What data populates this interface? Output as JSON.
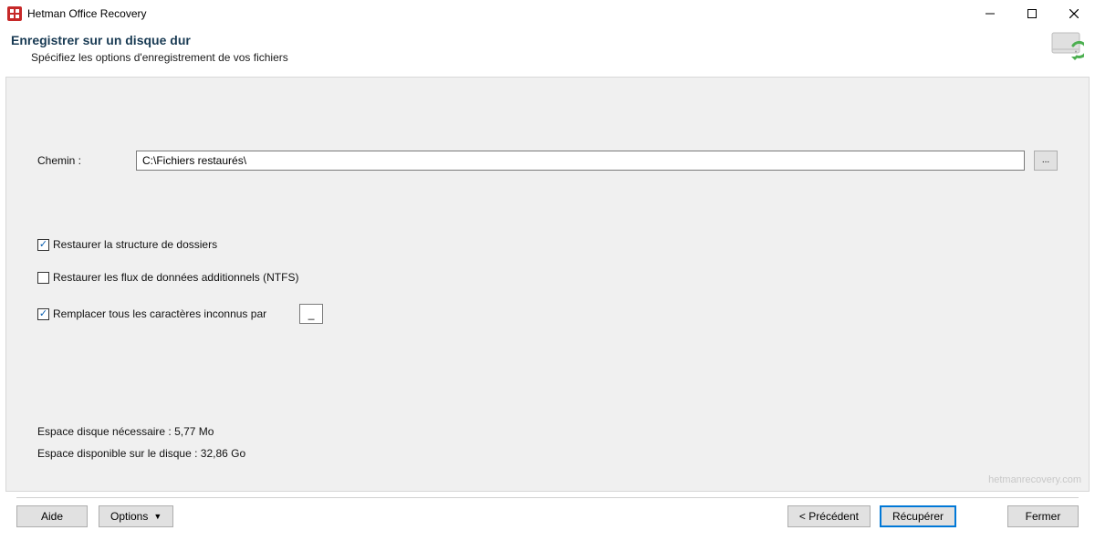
{
  "titlebar": {
    "appName": "Hetman Office Recovery"
  },
  "header": {
    "title": "Enregistrer sur un disque dur",
    "subtitle": "Spécifiez les options d'enregistrement de vos fichiers"
  },
  "form": {
    "pathLabel": "Chemin :",
    "pathValue": "C:\\Fichiers restaurés\\",
    "browseLabel": "...",
    "restoreStructure": {
      "checked": true,
      "label": "Restaurer la structure de dossiers"
    },
    "restoreNtfs": {
      "checked": false,
      "label": "Restaurer les flux de données additionnels (NTFS)"
    },
    "replaceUnknown": {
      "checked": true,
      "label": "Remplacer tous les caractères inconnus par",
      "charValue": "_"
    }
  },
  "disk": {
    "requiredLine": "Espace disque nécessaire : 5,77 Mo",
    "availableLine": "Espace disponible sur le disque : 32,86 Go"
  },
  "footer": {
    "help": "Aide",
    "options": "Options",
    "previous": "< Précédent",
    "recover": "Récupérer",
    "close": "Fermer"
  },
  "watermark": "hetmanrecovery.com"
}
